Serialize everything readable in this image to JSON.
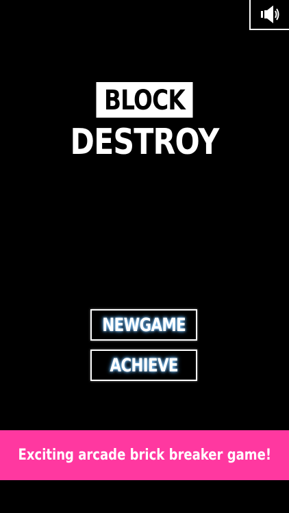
{
  "sound_button": {
    "icon": "speaker-volume-icon"
  },
  "title": {
    "line1": "BLOCK",
    "line2": "DESTROY"
  },
  "menu": {
    "new_game_label": "NEWGAME",
    "achieve_label": "ACHIEVE"
  },
  "banner": {
    "text": "Exciting arcade brick breaker game!"
  },
  "colors": {
    "background": "#000000",
    "foreground": "#ffffff",
    "banner": "#ff38a0",
    "button_glow": "#4aa8ff"
  }
}
